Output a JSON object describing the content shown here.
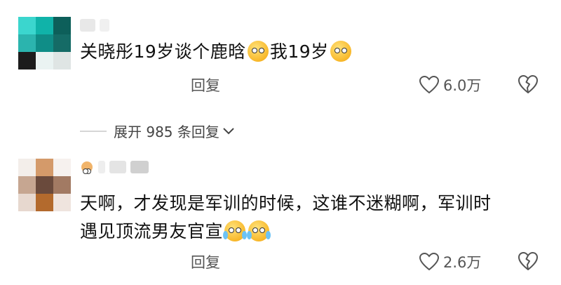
{
  "comments": [
    {
      "text_before": "关晓彤19岁谈个鹿晗",
      "text_middle": "我19岁",
      "reply_label": "回复",
      "like_count": "6.0万",
      "icons": [
        "squint-emoji-icon",
        "embarrassed-emoji-icon",
        "heart-outline-icon",
        "broken-heart-icon"
      ]
    },
    {
      "text_line1": "天啊，才发现是军训的时候，这谁不迷糊啊，军训时",
      "text_line2": "遇见顶流男友官宣",
      "reply_label": "回复",
      "like_count": "2.6万",
      "icons": [
        "laugh-cry-emoji-icon",
        "laugh-cry-emoji-icon",
        "heart-outline-icon",
        "broken-heart-icon"
      ]
    }
  ],
  "expand_replies": {
    "label": "展开 985 条回复"
  },
  "colors": {
    "text": "#111111",
    "muted": "#555555",
    "divider": "#d6d6d6",
    "emoji_yellow": "#f8b82a"
  }
}
